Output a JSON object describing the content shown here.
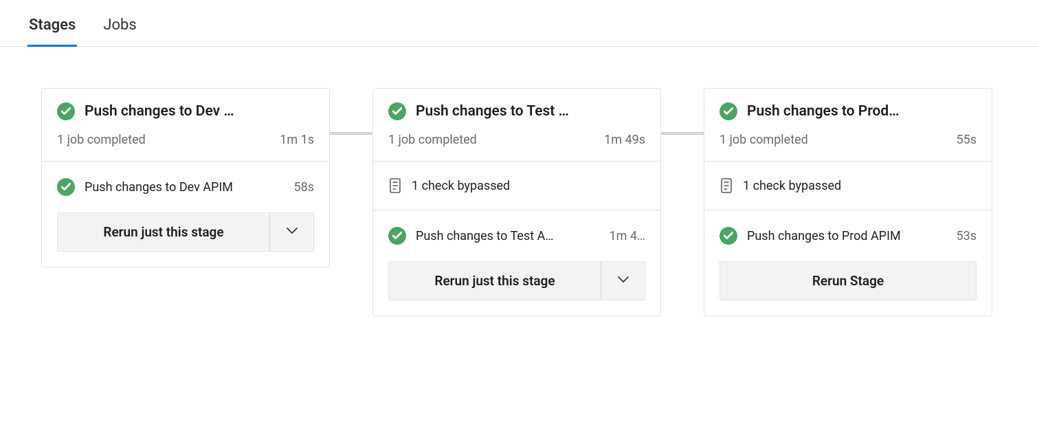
{
  "tabs": {
    "stages": "Stages",
    "jobs": "Jobs",
    "active": "stages"
  },
  "stages": [
    {
      "title": "Push changes to Dev …",
      "summary": "1 job completed",
      "duration": "1m 1s",
      "checks": null,
      "job": {
        "name": "Push changes to Dev APIM",
        "duration": "58s"
      },
      "action": {
        "type": "split",
        "label": "Rerun just this stage"
      }
    },
    {
      "title": "Push changes to Test …",
      "summary": "1 job completed",
      "duration": "1m 49s",
      "checks": "1 check bypassed",
      "job": {
        "name": "Push changes to Test A…",
        "duration": "1m 4…"
      },
      "action": {
        "type": "split",
        "label": "Rerun just this stage"
      }
    },
    {
      "title": "Push changes to Prod…",
      "summary": "1 job completed",
      "duration": "55s",
      "checks": "1 check bypassed",
      "job": {
        "name": "Push changes to Prod APIM",
        "duration": "53s"
      },
      "action": {
        "type": "single",
        "label": "Rerun Stage"
      }
    }
  ]
}
